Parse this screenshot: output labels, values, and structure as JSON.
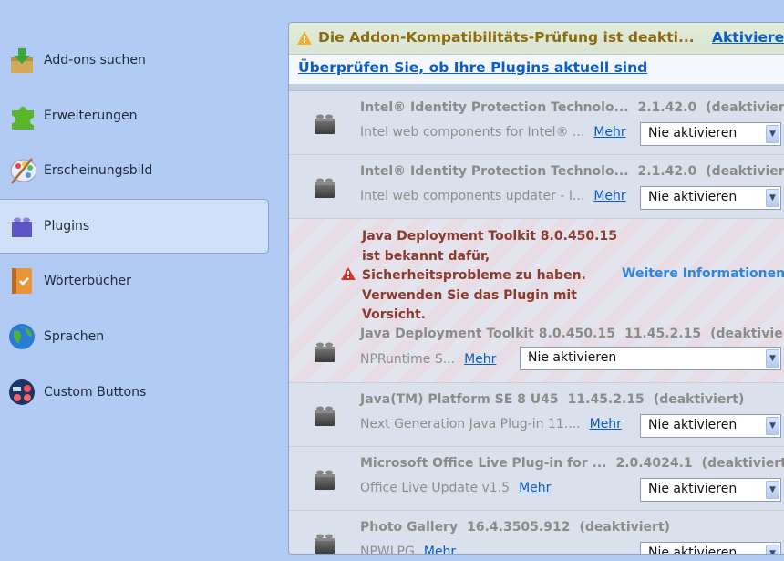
{
  "sidebar": {
    "items": [
      {
        "label": "Add-ons suchen",
        "icon": "download-box-icon"
      },
      {
        "label": "Erweiterungen",
        "icon": "puzzle-icon"
      },
      {
        "label": "Erscheinungsbild",
        "icon": "palette-icon"
      },
      {
        "label": "Plugins",
        "icon": "plugin-brick-icon",
        "selected": true
      },
      {
        "label": "Wörterbücher",
        "icon": "dictionary-icon"
      },
      {
        "label": "Sprachen",
        "icon": "globe-icon"
      },
      {
        "label": "Custom Buttons",
        "icon": "custom-buttons-icon"
      }
    ]
  },
  "notification": {
    "text": "Die Addon-Kompatibilitäts-Prüfung ist deakti...",
    "action": "Aktivieren"
  },
  "check_link": "Überprüfen Sie, ob Ihre Plugins aktuell sind",
  "plugins": [
    {
      "name": "Intel® Identity Protection Technolo...",
      "version": "2.1.42.0",
      "status": "(deaktiviert)",
      "desc": "Intel web components for Intel® ...",
      "more": "Mehr",
      "state": "Nie aktivieren"
    },
    {
      "name": "Intel® Identity Protection Technolo...",
      "version": "2.1.42.0",
      "status": "(deaktiviert)",
      "desc": "Intel web components updater - I...",
      "more": "Mehr",
      "state": "Nie aktivieren"
    },
    {
      "name": "Java Deployment Toolkit 8.0.450.15",
      "version": "11.45.2.15",
      "status": "(deaktiviert)",
      "desc": "NPRuntime S...",
      "more": "Mehr",
      "state": "Nie aktivieren",
      "warning": {
        "lines": [
          "Java Deployment Toolkit 8.0.450.15",
          "ist bekannt dafür,",
          "Sicherheitsprobleme zu haben.",
          "Verwenden Sie das Plugin mit",
          "Vorsicht."
        ],
        "link": "Weitere Informationen"
      }
    },
    {
      "name": "Java(TM) Platform SE 8 U45",
      "version": "11.45.2.15",
      "status": "(deaktiviert)",
      "desc": "Next Generation Java Plug-in 11....",
      "more": "Mehr",
      "state": "Nie aktivieren"
    },
    {
      "name": "Microsoft Office Live Plug-in for ...",
      "version": "2.0.4024.1",
      "status": "(deaktiviert)",
      "desc": "Office Live Update v1.5",
      "more": "Mehr",
      "state": "Nie aktivieren"
    },
    {
      "name": "Photo Gallery",
      "version": "16.4.3505.912",
      "status": "(deaktiviert)",
      "desc": "NPWLPG",
      "more": "Mehr",
      "state": "Nie aktivieren"
    }
  ]
}
